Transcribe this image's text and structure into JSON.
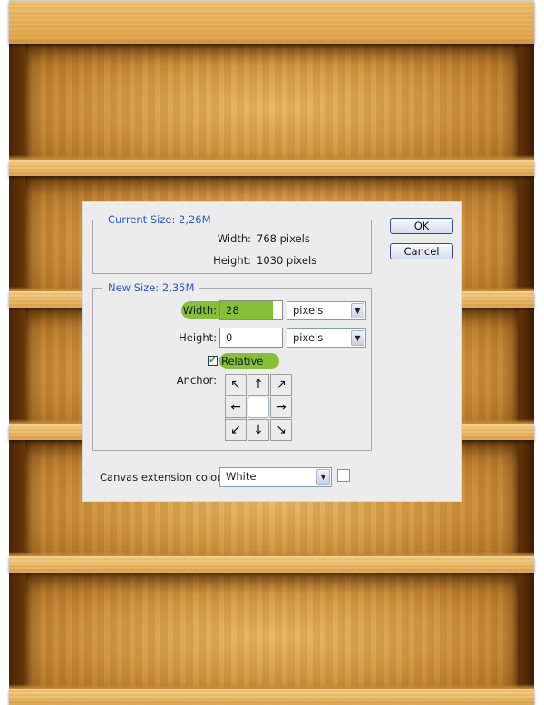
{
  "dialog": {
    "current_size": {
      "legend": "Current Size: 2,26M",
      "width_label": "Width:",
      "width_value": "768 pixels",
      "height_label": "Height:",
      "height_value": "1030 pixels"
    },
    "new_size": {
      "legend": "New Size: 2,35M",
      "width_label": "Width:",
      "width_value": "28",
      "width_unit": "pixels",
      "height_label": "Height:",
      "height_value": "0",
      "height_unit": "pixels",
      "relative_label": "Relative",
      "relative_checked": true,
      "anchor_label": "Anchor:",
      "anchor_arrows": [
        "↖",
        "↑",
        "↗",
        "←",
        "",
        "→",
        "↙",
        "↓",
        "↘"
      ]
    },
    "canvas_extension": {
      "label": "Canvas extension color:",
      "value": "White",
      "swatch_color": "#ffffff"
    },
    "buttons": {
      "ok": "OK",
      "cancel": "Cancel"
    },
    "check_mark": "✔",
    "dropdown_glyph": "▼"
  },
  "colors": {
    "highlight": "#86c03b",
    "legend_text": "#2b57c9",
    "button_border": "#2e4d8a"
  }
}
